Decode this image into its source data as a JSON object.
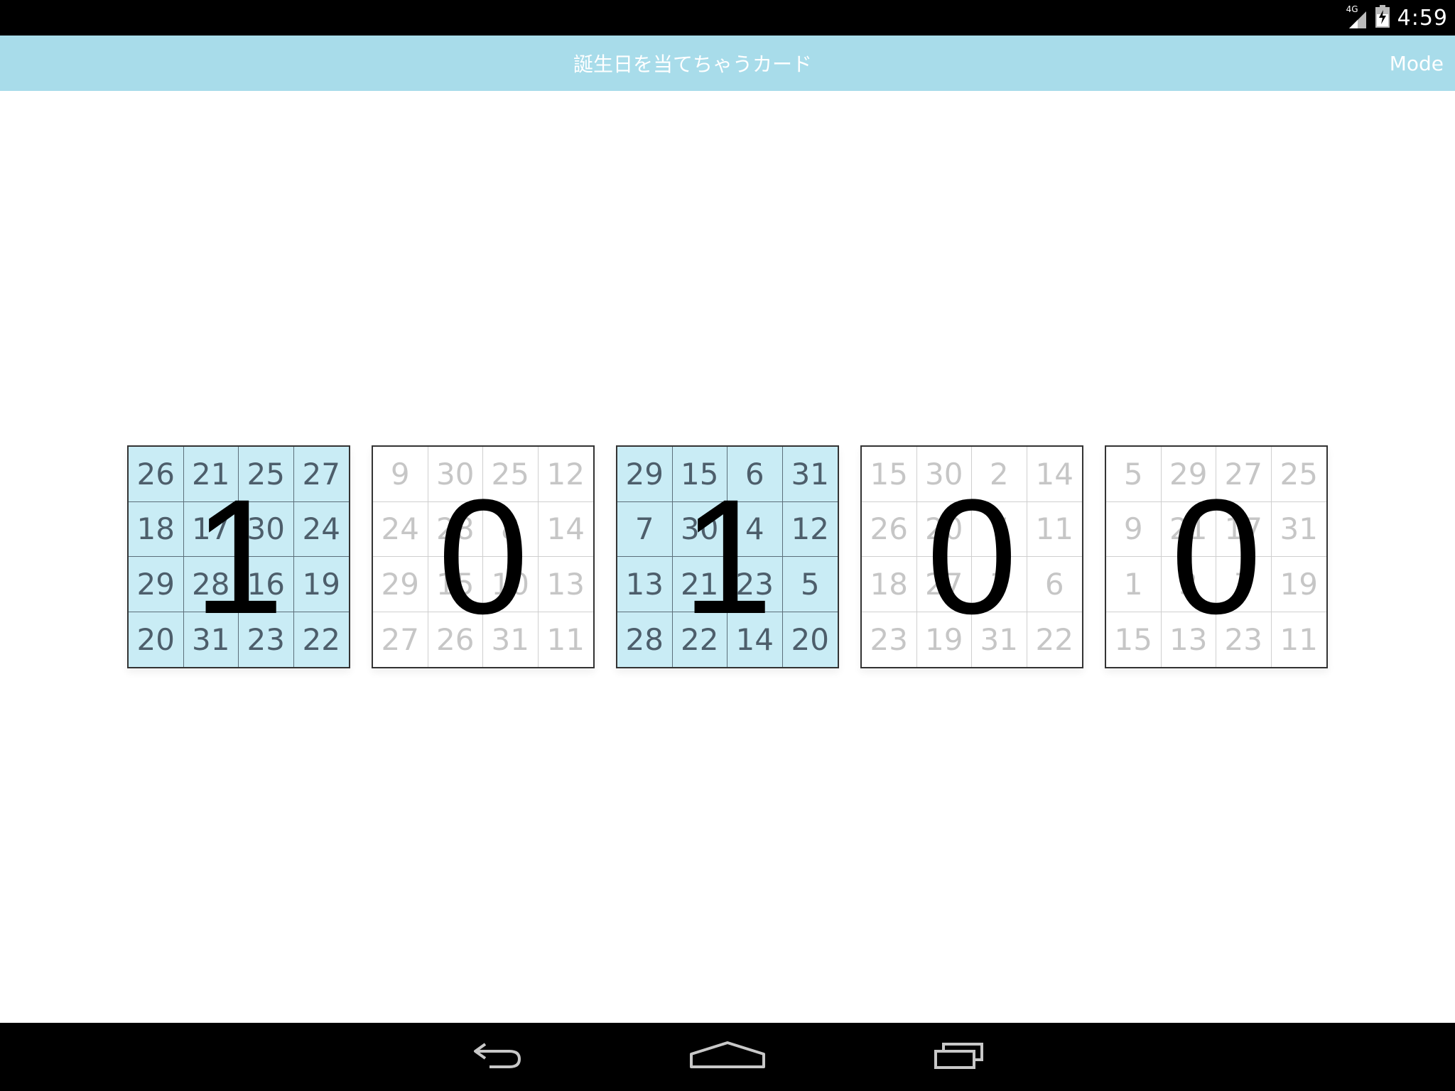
{
  "status_bar": {
    "network": "4G",
    "time": "4:59",
    "icons": [
      "signal-icon",
      "battery-icon"
    ]
  },
  "action_bar": {
    "title": "誕生日を当てちゃうカード",
    "mode_label": "Mode"
  },
  "cards": [
    {
      "active": true,
      "bit": "1",
      "numbers": [
        "26",
        "21",
        "25",
        "27",
        "18",
        "17",
        "30",
        "24",
        "29",
        "28",
        "16",
        "19",
        "20",
        "31",
        "23",
        "22"
      ]
    },
    {
      "active": false,
      "bit": "0",
      "numbers": [
        "9",
        "30",
        "25",
        "12",
        "24",
        "28",
        "8",
        "14",
        "29",
        "15",
        "10",
        "13",
        "27",
        "26",
        "31",
        "11"
      ]
    },
    {
      "active": true,
      "bit": "1",
      "numbers": [
        "29",
        "15",
        "6",
        "31",
        "7",
        "30",
        "4",
        "12",
        "13",
        "21",
        "23",
        "5",
        "28",
        "22",
        "14",
        "20"
      ]
    },
    {
      "active": false,
      "bit": "0",
      "numbers": [
        "15",
        "30",
        "2",
        "14",
        "26",
        "20",
        "7",
        "11",
        "18",
        "27",
        "3",
        "6",
        "23",
        "19",
        "31",
        "22"
      ]
    },
    {
      "active": false,
      "bit": "0",
      "numbers": [
        "5",
        "29",
        "27",
        "25",
        "9",
        "21",
        "17",
        "31",
        "1",
        "3",
        "7",
        "19",
        "15",
        "13",
        "23",
        "11"
      ]
    }
  ],
  "nav_bar": {
    "icons": [
      "back-icon",
      "home-icon",
      "recent-apps-icon"
    ]
  },
  "colors": {
    "action_bar": "#a8dcea",
    "active_card": "#c9ecf5",
    "active_number": "#4d5e6b",
    "inactive_number": "#c6c6c6"
  }
}
